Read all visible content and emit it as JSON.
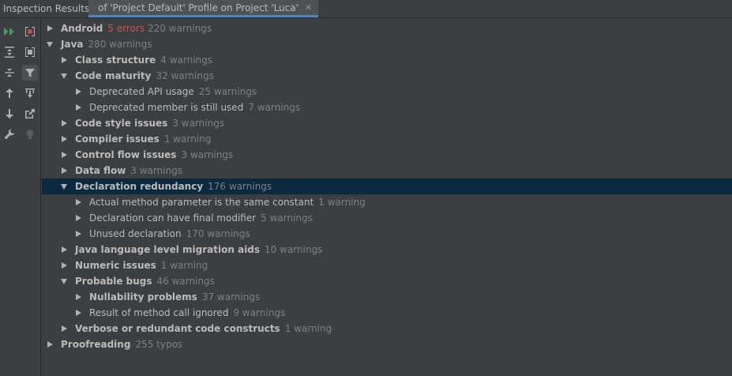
{
  "panel": {
    "title": "Inspection Results:"
  },
  "tab": {
    "label": "of 'Project Default' Profile on Project 'Luca'"
  },
  "toolbar": {
    "buttons": [
      {
        "icon": "rerun-icon"
      },
      {
        "icon": "stop-icon"
      },
      {
        "icon": "expand-all-icon"
      },
      {
        "icon": "group-icon"
      },
      {
        "icon": "collapse-all-icon"
      },
      {
        "icon": "filter-icon"
      },
      {
        "icon": "previous-icon"
      },
      {
        "icon": "autoscroll-icon"
      },
      {
        "icon": "next-icon"
      },
      {
        "icon": "export-icon"
      },
      {
        "icon": "settings-wrench-icon"
      },
      {
        "icon": "lightbulb-icon"
      }
    ]
  },
  "tree": [
    {
      "name": "Android",
      "errors": "5 errors",
      "count": "220 warnings",
      "level": 0,
      "expanded": false,
      "bold": true
    },
    {
      "name": "Java",
      "count": "280 warnings",
      "level": 0,
      "expanded": true,
      "bold": true
    },
    {
      "name": "Class structure",
      "count": "4 warnings",
      "level": 1,
      "expanded": false,
      "bold": true
    },
    {
      "name": "Code maturity",
      "count": "32 warnings",
      "level": 1,
      "expanded": true,
      "bold": true
    },
    {
      "name": "Deprecated API usage",
      "count": "25 warnings",
      "level": 2,
      "expanded": false,
      "bold": false
    },
    {
      "name": "Deprecated member is still used",
      "count": "7 warnings",
      "level": 2,
      "expanded": false,
      "bold": false
    },
    {
      "name": "Code style issues",
      "count": "3 warnings",
      "level": 1,
      "expanded": false,
      "bold": true
    },
    {
      "name": "Compiler issues",
      "count": "1 warning",
      "level": 1,
      "expanded": false,
      "bold": true
    },
    {
      "name": "Control flow issues",
      "count": "3 warnings",
      "level": 1,
      "expanded": false,
      "bold": true
    },
    {
      "name": "Data flow",
      "count": "3 warnings",
      "level": 1,
      "expanded": false,
      "bold": true
    },
    {
      "name": "Declaration redundancy",
      "count": "176 warnings",
      "level": 1,
      "expanded": true,
      "bold": true,
      "selected": true
    },
    {
      "name": "Actual method parameter is the same constant",
      "count": "1 warning",
      "level": 2,
      "expanded": false,
      "bold": false
    },
    {
      "name": "Declaration can have final modifier",
      "count": "5 warnings",
      "level": 2,
      "expanded": false,
      "bold": false
    },
    {
      "name": "Unused declaration",
      "count": "170 warnings",
      "level": 2,
      "expanded": false,
      "bold": false
    },
    {
      "name": "Java language level migration aids",
      "count": "10 warnings",
      "level": 1,
      "expanded": false,
      "bold": true
    },
    {
      "name": "Numeric issues",
      "count": "1 warning",
      "level": 1,
      "expanded": false,
      "bold": true
    },
    {
      "name": "Probable bugs",
      "count": "46 warnings",
      "level": 1,
      "expanded": true,
      "bold": true
    },
    {
      "name": "Nullability problems",
      "count": "37 warnings",
      "level": 2,
      "expanded": false,
      "bold": true
    },
    {
      "name": "Result of method call ignored",
      "count": "9 warnings",
      "level": 2,
      "expanded": false,
      "bold": false
    },
    {
      "name": "Verbose or redundant code constructs",
      "count": "1 warning",
      "level": 1,
      "expanded": false,
      "bold": true
    },
    {
      "name": "Proofreading",
      "count": "255 typos",
      "level": 0,
      "expanded": false,
      "bold": true
    }
  ]
}
